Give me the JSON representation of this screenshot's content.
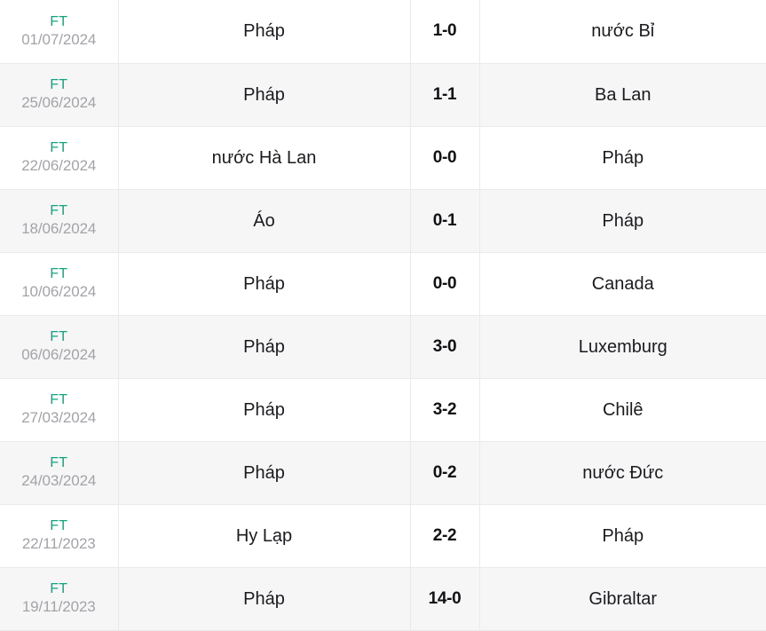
{
  "page": {
    "title": "Football match results list",
    "background_color": "#ffffff",
    "row_border_color": "#eaeaec",
    "row_colors": {
      "odd": "#ffffff",
      "even": "#f6f6f7"
    }
  },
  "colors": {
    "status_green": "#14a37f",
    "date_gray": "#a3a3a8",
    "score_black": "#111114",
    "team_black": "#1b1b1f"
  },
  "matches": [
    {
      "status": "FT",
      "date": "01/07/2024",
      "home": "Pháp",
      "score": "1-0",
      "away": "nước Bỉ"
    },
    {
      "status": "FT",
      "date": "25/06/2024",
      "home": "Pháp",
      "score": "1-1",
      "away": "Ba Lan"
    },
    {
      "status": "FT",
      "date": "22/06/2024",
      "home": "nước Hà Lan",
      "score": "0-0",
      "away": "Pháp"
    },
    {
      "status": "FT",
      "date": "18/06/2024",
      "home": "Áo",
      "score": "0-1",
      "away": "Pháp"
    },
    {
      "status": "FT",
      "date": "10/06/2024",
      "home": "Pháp",
      "score": "0-0",
      "away": "Canada"
    },
    {
      "status": "FT",
      "date": "06/06/2024",
      "home": "Pháp",
      "score": "3-0",
      "away": "Luxemburg"
    },
    {
      "status": "FT",
      "date": "27/03/2024",
      "home": "Pháp",
      "score": "3-2",
      "away": "Chilê"
    },
    {
      "status": "FT",
      "date": "24/03/2024",
      "home": "Pháp",
      "score": "0-2",
      "away": "nước Đức"
    },
    {
      "status": "FT",
      "date": "22/11/2023",
      "home": "Hy Lạp",
      "score": "2-2",
      "away": "Pháp"
    },
    {
      "status": "FT",
      "date": "19/11/2023",
      "home": "Pháp",
      "score": "14-0",
      "away": "Gibraltar"
    }
  ]
}
